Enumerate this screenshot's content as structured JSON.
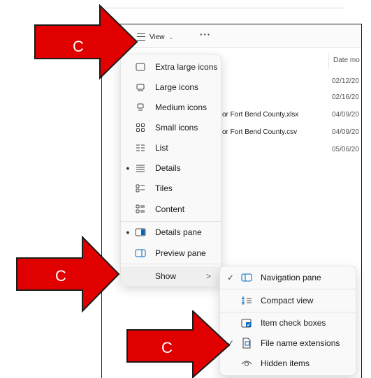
{
  "toolbar": {
    "view_label": "View",
    "more_label": "···"
  },
  "file_list": {
    "date_header": "Date mo",
    "rows": [
      {
        "name": "",
        "date": "02/12/20"
      },
      {
        "name": "",
        "date": "02/16/20"
      },
      {
        "name": "or Fort Bend County.xlsx",
        "date": "04/09/20"
      },
      {
        "name": "or Fort Bend County.csv",
        "date": "04/09/20"
      },
      {
        "name": "",
        "date": "05/06/20"
      }
    ]
  },
  "view_menu": {
    "items": [
      {
        "label": "Extra large icons",
        "icon": "extra-large-icons-icon",
        "selected": false
      },
      {
        "label": "Large icons",
        "icon": "large-icons-icon",
        "selected": false
      },
      {
        "label": "Medium icons",
        "icon": "medium-icons-icon",
        "selected": false
      },
      {
        "label": "Small icons",
        "icon": "small-icons-icon",
        "selected": false
      },
      {
        "label": "List",
        "icon": "list-icon",
        "selected": false
      },
      {
        "label": "Details",
        "icon": "details-icon",
        "selected": true
      },
      {
        "label": "Tiles",
        "icon": "tiles-icon",
        "selected": false
      },
      {
        "label": "Content",
        "icon": "content-icon",
        "selected": false
      }
    ],
    "panes": [
      {
        "label": "Details pane",
        "icon": "details-pane-icon",
        "selected": true
      },
      {
        "label": "Preview pane",
        "icon": "preview-pane-icon",
        "selected": false
      }
    ],
    "show_label": "Show",
    "show_chevron": ">"
  },
  "show_menu": {
    "items": [
      {
        "label": "Navigation pane",
        "icon": "navigation-pane-icon",
        "checked": true
      },
      {
        "label": "Compact view",
        "icon": "compact-view-icon",
        "checked": false
      },
      {
        "label": "Item check boxes",
        "icon": "item-check-boxes-icon",
        "checked": false
      },
      {
        "label": "File name extensions",
        "icon": "file-name-extensions-icon",
        "checked": true
      },
      {
        "label": "Hidden items",
        "icon": "hidden-items-icon",
        "checked": false
      }
    ]
  },
  "annotations": {
    "arrow_1_letter": "C",
    "arrow_2_letter": "C",
    "arrow_3_letter": "C",
    "arrow_color": "#e00000"
  },
  "colors": {
    "accent_blue": "#0067c0",
    "menu_bg": "#f9f9f9"
  }
}
